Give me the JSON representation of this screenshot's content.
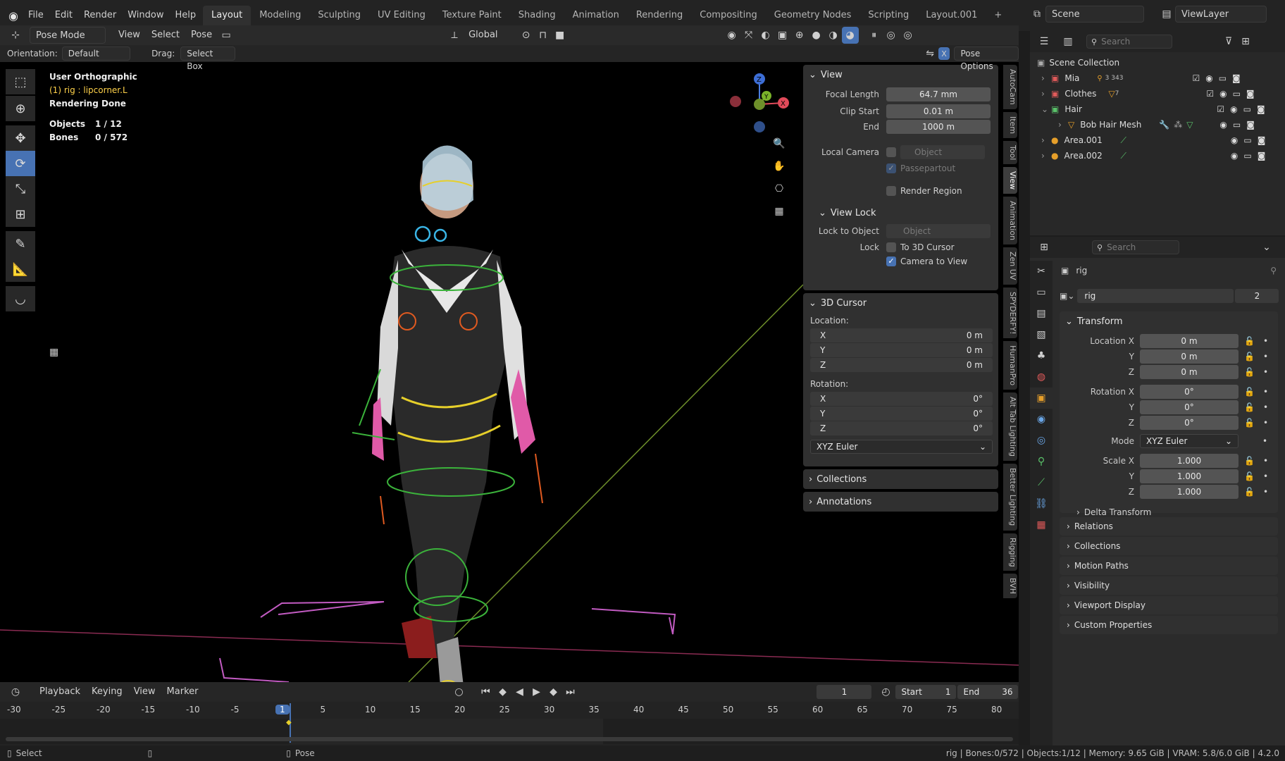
{
  "menubar": {
    "items": [
      "File",
      "Edit",
      "Render",
      "Window",
      "Help"
    ],
    "workspaces": [
      "Layout",
      "Modeling",
      "Sculpting",
      "UV Editing",
      "Texture Paint",
      "Shading",
      "Animation",
      "Rendering",
      "Compositing",
      "Geometry Nodes",
      "Scripting",
      "Layout.001"
    ],
    "active_workspace": "Layout",
    "add_tab": "+",
    "scene": "Scene",
    "view_layer": "ViewLayer"
  },
  "view_header": {
    "mode": "Pose Mode",
    "menus": [
      "View",
      "Select",
      "Pose"
    ],
    "transform_orientation": "Global"
  },
  "tool_settings": {
    "orientation_label": "Orientation:",
    "orientation_value": "Default",
    "drag_label": "Drag:",
    "drag_value": "Select Box",
    "pose_options": "Pose Options",
    "x_mirror": "X"
  },
  "viewport_info": {
    "view_name": "User Orthographic",
    "active": "(1) rig : lipcorner.L",
    "status": "Rendering Done",
    "objects_label": "Objects",
    "objects_value": "1 / 12",
    "bones_label": "Bones",
    "bones_value": "0 / 572"
  },
  "npanel": {
    "view": {
      "title": "View",
      "focal_length_label": "Focal Length",
      "focal_length": "64.7 mm",
      "clip_start_label": "Clip Start",
      "clip_start": "0.01 m",
      "clip_end_label": "End",
      "clip_end": "1000 m",
      "local_camera_label": "Local Camera",
      "local_camera_placeholder": "Object",
      "passepartout": "Passepartout",
      "render_region": "Render Region"
    },
    "view_lock": {
      "title": "View Lock",
      "lock_to_object_label": "Lock to Object",
      "lock_to_object_placeholder": "Object",
      "lock_label": "Lock",
      "to_3d_cursor": "To 3D Cursor",
      "camera_to_view": "Camera to View"
    },
    "cursor": {
      "title": "3D Cursor",
      "location_label": "Location:",
      "loc": [
        {
          "axis": "X",
          "value": "0 m"
        },
        {
          "axis": "Y",
          "value": "0 m"
        },
        {
          "axis": "Z",
          "value": "0 m"
        }
      ],
      "rotation_label": "Rotation:",
      "rot": [
        {
          "axis": "X",
          "value": "0°"
        },
        {
          "axis": "Y",
          "value": "0°"
        },
        {
          "axis": "Z",
          "value": "0°"
        }
      ],
      "rotation_mode": "XYZ Euler"
    },
    "collections": "Collections",
    "annotations": "Annotations"
  },
  "vtabs": [
    "AutoCam",
    "Item",
    "Tool",
    "View",
    "Animation",
    "Zen UV",
    "SPYDERFY!",
    "HumanPro",
    "Alt Tab Lighting",
    "Better Lighting",
    "Rigging",
    "BVH"
  ],
  "outliner": {
    "search_placeholder": "Search",
    "root": "Scene Collection",
    "items": [
      {
        "name": "Mia",
        "badge": "3 343"
      },
      {
        "name": "Clothes",
        "badge": "7"
      },
      {
        "name": "Hair",
        "badge": ""
      },
      {
        "name": "Bob Hair Mesh",
        "badge": ""
      },
      {
        "name": "Area.001",
        "badge": ""
      },
      {
        "name": "Area.002",
        "badge": ""
      }
    ]
  },
  "properties": {
    "search_placeholder": "Search",
    "object_name": "rig",
    "data_name": "rig",
    "users": "2",
    "transform_title": "Transform",
    "location_x_label": "Location X",
    "location": [
      "0 m",
      "0 m",
      "0 m"
    ],
    "rotation_x_label": "Rotation X",
    "rotation": [
      "0°",
      "0°",
      "0°"
    ],
    "mode_label": "Mode",
    "mode_value": "XYZ Euler",
    "scale_x_label": "Scale X",
    "scale": [
      "1.000",
      "1.000",
      "1.000"
    ],
    "y_label": "Y",
    "z_label": "Z",
    "delta_transform": "Delta Transform",
    "subpanels": [
      "Relations",
      "Collections",
      "Motion Paths",
      "Visibility",
      "Viewport Display",
      "Custom Properties"
    ]
  },
  "timeline": {
    "menus": [
      "Playback",
      "Keying",
      "View",
      "Marker"
    ],
    "current_frame": "1",
    "start_label": "Start",
    "start": "1",
    "end_label": "End",
    "end": "36",
    "ticks": [
      "-30",
      "-25",
      "-20",
      "-15",
      "-10",
      "-5",
      "1",
      "5",
      "10",
      "15",
      "20",
      "25",
      "30",
      "35",
      "40",
      "45",
      "50",
      "55",
      "60",
      "65",
      "70",
      "75",
      "80"
    ]
  },
  "status": {
    "left_select": "Select",
    "pose": "Pose",
    "right": "rig | Bones:0/572 | Objects:1/12 | Memory: 9.65 GiB | VRAM: 5.8/6.0 GiB | 4.2.0"
  },
  "colors": {
    "accent": "#4772b3",
    "info_yellow": "#ffd24a"
  }
}
